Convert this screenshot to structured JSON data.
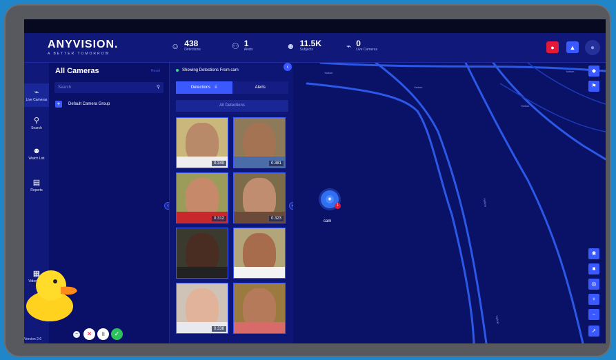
{
  "app": {
    "logo": "ANYVISION.",
    "tagline": "A BETTER TOMORROW"
  },
  "stats": [
    {
      "icon": "detections-icon",
      "glyph": "☺",
      "value": "438",
      "label": "Detections"
    },
    {
      "icon": "alerts-icon",
      "glyph": "⚇",
      "value": "1",
      "label": "Alerts"
    },
    {
      "icon": "subjects-icon",
      "glyph": "☻",
      "value": "11.5K",
      "label": "Subjects"
    },
    {
      "icon": "live-cameras-icon",
      "glyph": "⌁",
      "value": "0",
      "label": "Live Cameras"
    }
  ],
  "sidebar": {
    "items": [
      {
        "label": "Live Cameras",
        "glyph": "⌁"
      },
      {
        "label": "Search",
        "glyph": "⚲"
      },
      {
        "label": "Watch List",
        "glyph": "☻"
      },
      {
        "label": "Reports",
        "glyph": "▤"
      },
      {
        "label": "Video Wall",
        "glyph": "▦"
      }
    ]
  },
  "cameras": {
    "title": "All Cameras",
    "reset": "Reset",
    "search_placeholder": "Search",
    "group": "Default Camera Group"
  },
  "detections": {
    "showing": "Showing Detections From cam",
    "tabs": [
      "Detections",
      "Alerts"
    ],
    "filter": "All Detections",
    "scores": [
      "0.340",
      "0.381",
      "0.312",
      "0.323",
      "",
      "",
      "0.338",
      ""
    ]
  },
  "map": {
    "camera_label": "cam",
    "camera_badge": "1",
    "road_labels": [
      "Yarkon",
      "Yarkon",
      "Yarkon",
      "Yarkon",
      "Yarkon",
      "Yarkon"
    ]
  },
  "version": "Version 2.6",
  "colors": {
    "accent": "#3a59ff",
    "topbar": "#10197a",
    "alert": "#e3193a"
  }
}
